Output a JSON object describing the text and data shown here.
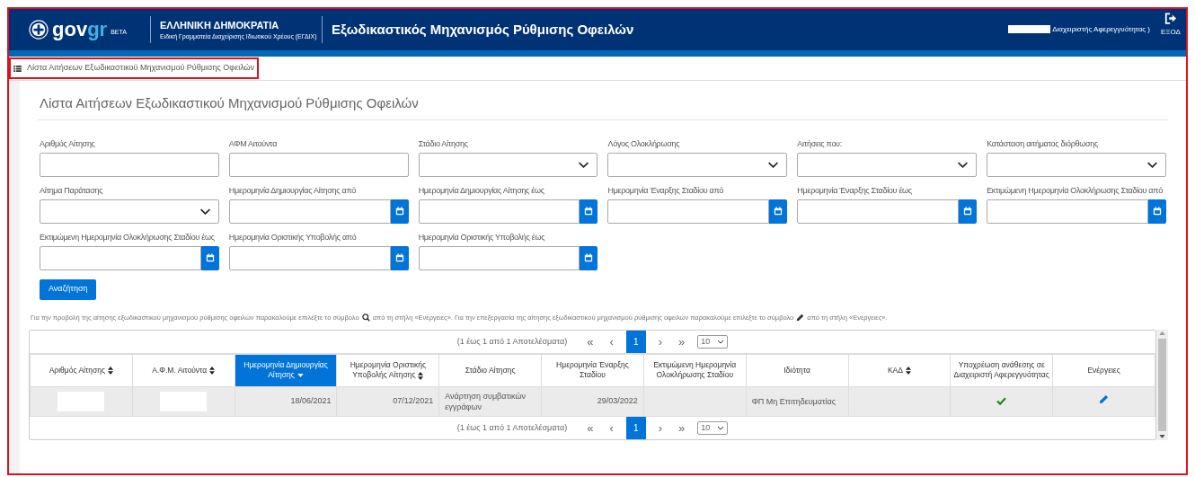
{
  "header": {
    "logo": {
      "gov": "gov",
      "gr": "gr",
      "badge": "BETA"
    },
    "org_title": "ΕΛΛΗΝΙΚΗ ΔΗΜΟΚΡΑΤΙΑ",
    "org_subtitle": "Ειδική Γραμματεία Διαχείρισης Ιδιωτικού Χρέους (ΕΓΔΙΧ)",
    "app_title": "Εξωδικαστικός Μηχανισμός Ρύθμισης Οφειλών",
    "user_role": "Διαχειριστής Αφερεγγυότητας )",
    "logout": "ΕΞΟΔ"
  },
  "breadcrumb": "Λίστα Αιτήσεων Εξωδικαστικού Μηχανισμού Ρύθμισης Οφειλών",
  "page_title": "Λίστα Αιτήσεων Εξωδικαστικού Μηχανισμού Ρύθμισης Οφειλών",
  "filters": [
    {
      "label": "Αριθμός Αίτησης",
      "kind": "text"
    },
    {
      "label": "ΑΦΜ Αιτούντα",
      "kind": "text"
    },
    {
      "label": "Στάδιο Αίτησης",
      "kind": "select"
    },
    {
      "label": "Λόγος Ολοκλήρωσης",
      "kind": "select"
    },
    {
      "label": "Αιτήσεις που:",
      "kind": "select"
    },
    {
      "label": "Κατάσταση αιτήματος διόρθωσης",
      "kind": "select"
    },
    {
      "label": "Αίτημα Παράτασης",
      "kind": "select"
    },
    {
      "label": "Ημερομηνία Δημιουργίας Αίτησης από",
      "kind": "date"
    },
    {
      "label": "Ημερομηνία Δημιουργίας Αίτησης έως",
      "kind": "date"
    },
    {
      "label": "Ημερομηνία Έναρξης Σταδίου από",
      "kind": "date"
    },
    {
      "label": "Ημερομηνία Έναρξης Σταδίου έως",
      "kind": "date"
    },
    {
      "label": "Εκτιμώμενη Ημερομηνία Ολοκλήρωσης Σταδίου από",
      "kind": "date"
    },
    {
      "label": "Εκτιμώμενη Ημερομηνία Ολοκλήρωσης Σταδίου έως",
      "kind": "date"
    },
    {
      "label": "Ημερομηνία Οριστικής Υποβολής από",
      "kind": "date"
    },
    {
      "label": "Ημερομηνία Οριστικής Υποβολής έως",
      "kind": "date"
    }
  ],
  "search_button": "Αναζήτηση",
  "info": {
    "part_1": "Για την προβολή της αίτησης εξωδικαστικού μηχανισμού ρύθμισης οφειλών παρακαλούμε επιλέξτε το σύμβολο",
    "part_2": "από τη στήλη «Ενέργειες». Για την επεξεργασία της αίτησης εξωδικαστικού μηχανισμού ρύθμισης οφειλών παρακαλούμε επιλέξτε το σύμβολο",
    "part_3": "από τη στήλη «Ενέργειες»."
  },
  "pagination_top": {
    "summary": "(1 έως 1 από 1 Αποτελέσματα)",
    "first": "«",
    "prev": "‹",
    "pages": [
      {
        "label": "1",
        "selected": true
      }
    ],
    "next": "›",
    "last": "»",
    "page_size": "10"
  },
  "table": {
    "columns": [
      {
        "label": "Αριθμός Αίτησης",
        "kind": "sortable",
        "selected": false
      },
      {
        "label": "Α.Φ.Μ. Αιτούντα",
        "kind": "sortable",
        "selected": false
      },
      {
        "label": "Ημερομηνία Δημιουργίας Αίτησης",
        "kind": "sorted",
        "selected": true
      },
      {
        "label": "Ημερομηνία Οριστικής Υποβολής Αίτησης",
        "kind": "sortable",
        "selected": false
      },
      {
        "label": "Στάδιο Αίτησης",
        "kind": "plain",
        "selected": false
      },
      {
        "label": "Ημερομηνία Έναρξης Σταδίου",
        "kind": "plain",
        "selected": false
      },
      {
        "label": "Εκτιμώμενη Ημερομηνία Ολοκλήρωσης Σταδίου",
        "kind": "plain",
        "selected": false
      },
      {
        "label": "Ιδιότητα",
        "kind": "plain",
        "selected": false
      },
      {
        "label": "ΚΑΔ",
        "kind": "sortable",
        "selected": false
      },
      {
        "label": "Υποχρέωση ανάθεσης σε Διαχειριστή Αφερεγγυότητας",
        "kind": "plain",
        "selected": false
      },
      {
        "label": "Ενέργειες",
        "kind": "plain",
        "selected": false
      }
    ],
    "rows": [
      {
        "cells": [
          {
            "kind": "redacted"
          },
          {
            "kind": "redacted"
          },
          {
            "kind": "date",
            "text": "18/06/2021"
          },
          {
            "kind": "date",
            "text": "07/12/2021"
          },
          {
            "kind": "text",
            "text": "Ανάρτηση συμβατικών εγγράφων"
          },
          {
            "kind": "date",
            "text": "29/03/2022"
          },
          {
            "kind": "empty"
          },
          {
            "kind": "text",
            "text": "ΦΠ Μη Επιτηδευματίας"
          },
          {
            "kind": "empty"
          },
          {
            "kind": "check"
          },
          {
            "kind": "edit"
          }
        ]
      }
    ]
  },
  "pagination_bottom": {
    "summary": "(1 έως 1 από 1 Αποτελέσματα)",
    "first": "«",
    "prev": "‹",
    "pages": [
      {
        "label": "1",
        "selected": true
      }
    ],
    "next": "›",
    "last": "»",
    "page_size": "10"
  }
}
